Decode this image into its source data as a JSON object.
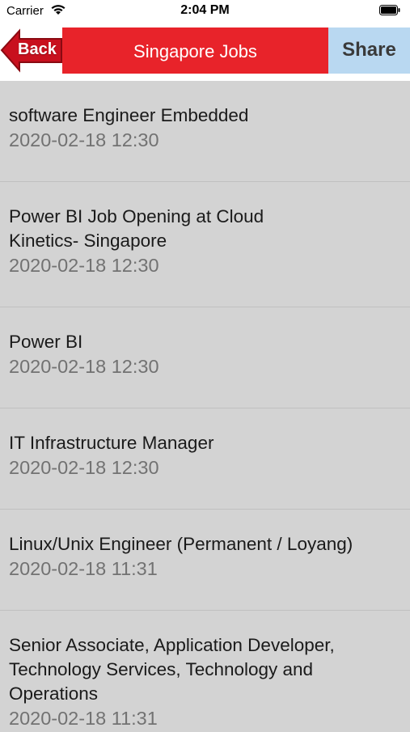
{
  "status": {
    "carrier": "Carrier",
    "time": "2:04 PM"
  },
  "nav": {
    "back_label": "Back",
    "title": "Singapore Jobs",
    "share_label": "Share"
  },
  "jobs": [
    {
      "title": "software Engineer Embedded",
      "date": "2020-02-18 12:30"
    },
    {
      "title": "Power BI Job Opening at Cloud Kinetics- Singapore",
      "date": "2020-02-18 12:30"
    },
    {
      "title": "Power BI",
      "date": "2020-02-18 12:30"
    },
    {
      "title": "IT Infrastructure Manager",
      "date": "2020-02-18 12:30"
    },
    {
      "title": "Linux/Unix Engineer (Permanent / Loyang)",
      "date": "2020-02-18 11:31"
    },
    {
      "title": "Senior Associate, Application Developer, Technology Services, Technology and Operations",
      "date": "2020-02-18 11:31"
    }
  ],
  "colors": {
    "nav_red": "#e8232a",
    "share_blue": "#b9d8f1",
    "list_bg": "#d3d3d3"
  }
}
